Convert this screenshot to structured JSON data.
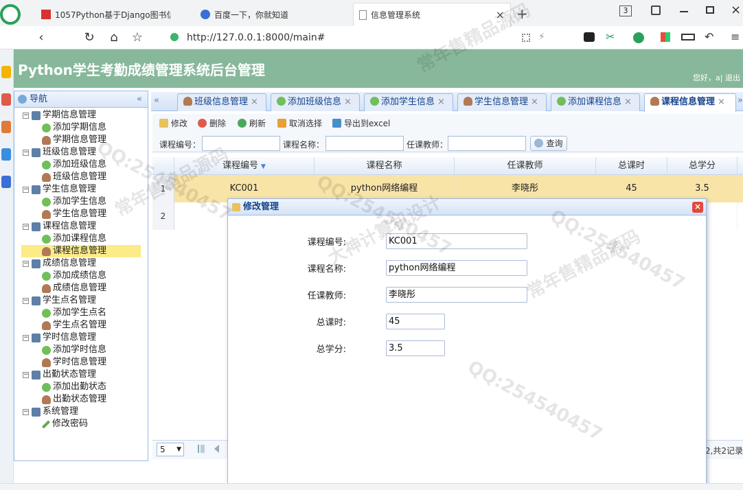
{
  "browser": {
    "tabs": [
      {
        "title": "1057Python基于Django图书信",
        "icon": "red-square-icon"
      },
      {
        "title": "百度一下，你就知道",
        "icon": "paw-icon"
      },
      {
        "title": "信息管理系统",
        "icon": "page-icon",
        "close": "×"
      }
    ],
    "new_tab": "+",
    "tab_count": "3",
    "url": "http://127.0.0.1:8000/main#"
  },
  "header": {
    "title": "Python学生考勤成绩管理系统后台管理",
    "welcome": "您好，a| 退出"
  },
  "nav": {
    "title": "导航",
    "collapse": "«",
    "groups": [
      {
        "label": "学期信息管理",
        "items": [
          "添加学期信息",
          "学期信息管理"
        ]
      },
      {
        "label": "班级信息管理",
        "items": [
          "添加班级信息",
          "班级信息管理"
        ]
      },
      {
        "label": "学生信息管理",
        "items": [
          "添加学生信息",
          "学生信息管理"
        ]
      },
      {
        "label": "课程信息管理",
        "items": [
          "添加课程信息",
          "课程信息管理"
        ]
      },
      {
        "label": "成绩信息管理",
        "items": [
          "添加成绩信息",
          "成绩信息管理"
        ]
      },
      {
        "label": "学生点名管理",
        "items": [
          "添加学生点名",
          "学生点名管理"
        ]
      },
      {
        "label": "学时信息管理",
        "items": [
          "添加学时信息",
          "学时信息管理"
        ]
      },
      {
        "label": "出勤状态管理",
        "items": [
          "添加出勤状态",
          "出勤状态管理"
        ]
      },
      {
        "label": "系统管理",
        "items": [
          "修改密码"
        ]
      }
    ],
    "selected": "课程信息管理"
  },
  "main_tabs": {
    "scroll_left": "«",
    "scroll_right": "»",
    "items": [
      {
        "label": "班级信息管理",
        "close": "×"
      },
      {
        "label": "添加班级信息",
        "close": "×"
      },
      {
        "label": "添加学生信息",
        "close": "×"
      },
      {
        "label": "学生信息管理",
        "close": "×"
      },
      {
        "label": "添加课程信息",
        "close": "×"
      },
      {
        "label": "课程信息管理",
        "close": "×"
      }
    ]
  },
  "toolbar": {
    "edit": "修改",
    "delete": "删除",
    "refresh": "刷新",
    "deselect": "取消选择",
    "export": "导出到excel",
    "filters": {
      "course_no": "课程编号：",
      "course_name": "课程名称：",
      "teacher": "任课教师："
    },
    "search": "查询"
  },
  "grid": {
    "columns": [
      "课程编号",
      "课程名称",
      "任课教师",
      "总课时",
      "总学分"
    ],
    "sort_indicator": "▼",
    "rows": [
      {
        "num": "1",
        "cells": [
          "KC001",
          "python网络编程",
          "李晓彤",
          "45",
          "3.5"
        ]
      },
      {
        "num": "2",
        "cells": [
          "",
          "",
          "",
          "",
          ""
        ]
      }
    ],
    "page_size": "5",
    "page_info": "2,共2记录"
  },
  "dialog": {
    "title": "修改管理",
    "close": "×",
    "fields": [
      {
        "label": "课程编号:",
        "value": "KC001"
      },
      {
        "label": "课程名称:",
        "value": "python网络编程"
      },
      {
        "label": "任课教师:",
        "value": "李晓彤"
      },
      {
        "label": "总课时:",
        "value": "45"
      },
      {
        "label": "总学分:",
        "value": "3.5"
      }
    ]
  },
  "watermarks": [
    "QQ:254540457",
    "常年售精品源码",
    "大神计算机设计"
  ],
  "colors": {
    "header_bg": "#87b89b",
    "selected_row": "#f9e4a8",
    "panel_border": "#99bbe8",
    "title_text": "#15428b"
  }
}
